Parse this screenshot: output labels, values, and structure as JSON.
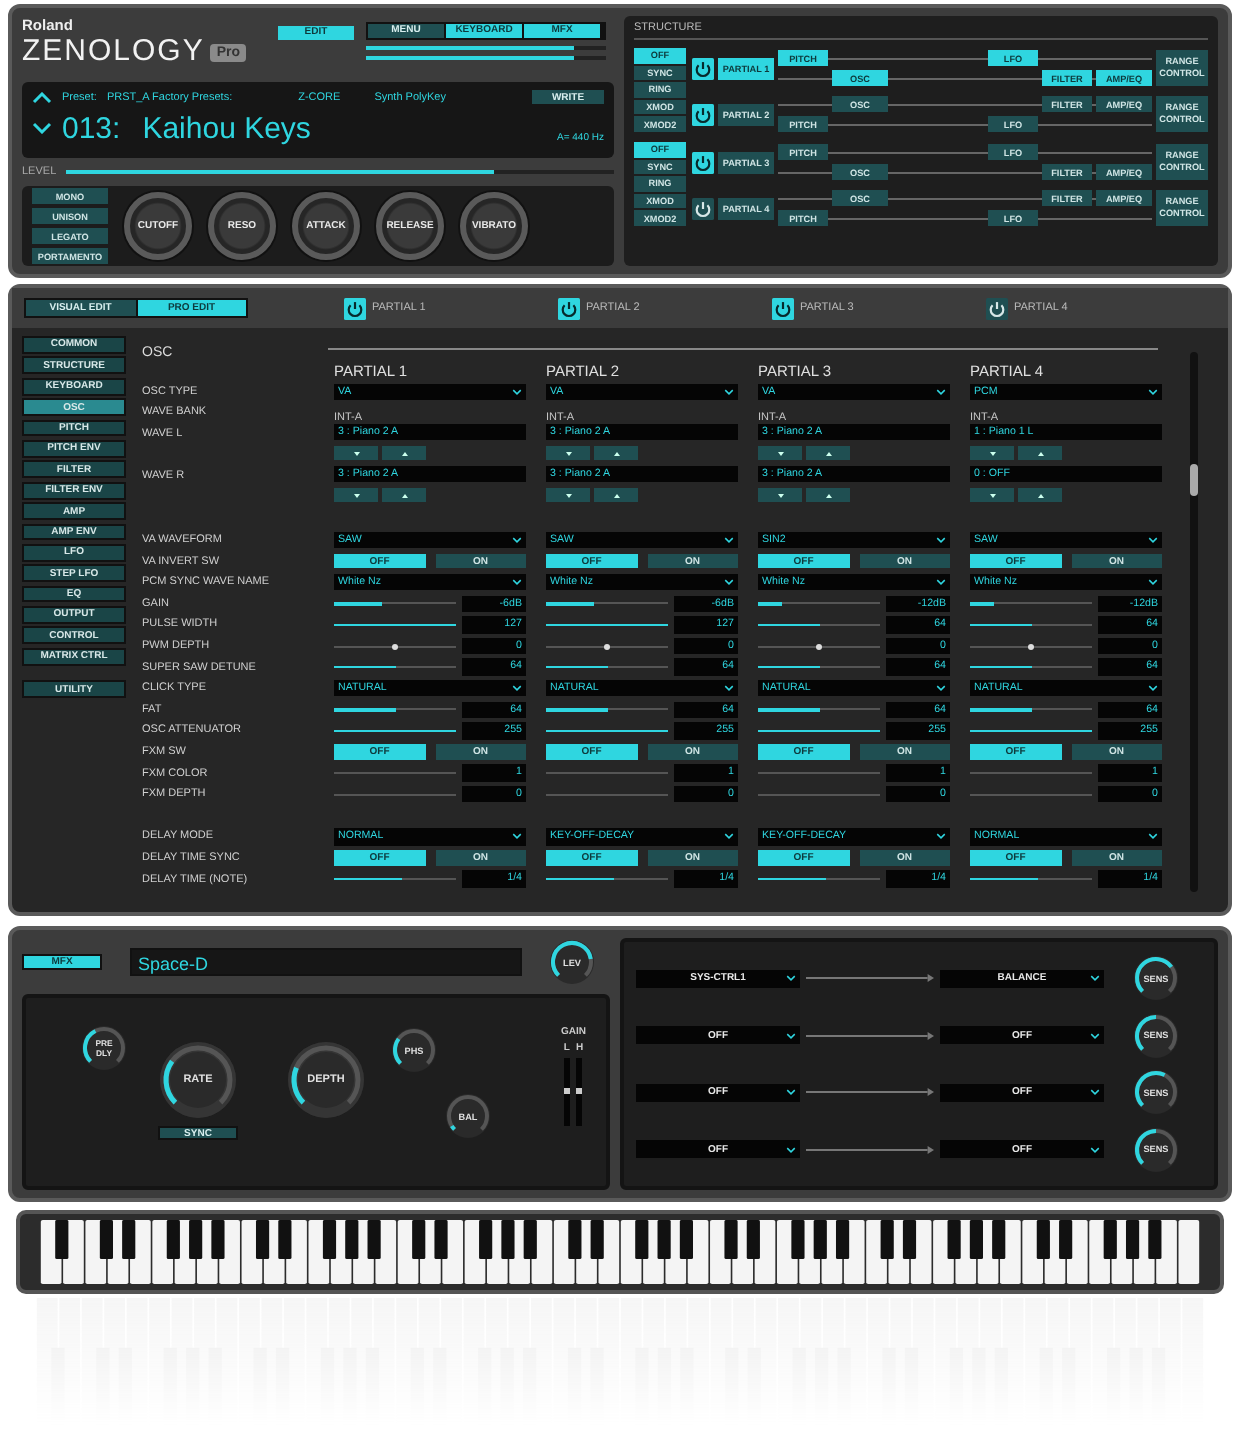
{
  "header": {
    "brand": "Roland",
    "product": "ZENOLOGY",
    "edition": "Pro",
    "edit_button": {
      "label": "EDIT",
      "selected": true
    },
    "nav_tabs": [
      {
        "label": "MENU",
        "selected": false
      },
      {
        "label": "KEYBOARD",
        "selected": true
      },
      {
        "label": "MFX",
        "selected": true
      }
    ],
    "meters": [
      {
        "level": 0.87
      },
      {
        "level": 0.87
      }
    ]
  },
  "preset": {
    "label": "Preset:",
    "bank": "PRST_A Factory Presets:",
    "engine": "Z-CORE",
    "category": "Synth PolyKey",
    "write": "WRITE",
    "number": "013:",
    "name": "Kaihou Keys",
    "tuning": "A= 440 Hz"
  },
  "level": {
    "label": "LEVEL",
    "level": 0.78
  },
  "voice_buttons": [
    "MONO",
    "UNISON",
    "LEGATO",
    "PORTAMENTO"
  ],
  "knobs": [
    "CUTOFF",
    "RESO",
    "ATTACK",
    "RELEASE",
    "VIBRATO"
  ],
  "structure": {
    "title": "STRUCTURE",
    "groups": [
      {
        "modes": [
          {
            "label": "OFF",
            "selected": true
          },
          {
            "label": "SYNC",
            "selected": false
          },
          {
            "label": "RING",
            "selected": false
          },
          {
            "label": "XMOD",
            "selected": false
          },
          {
            "label": "XMOD2",
            "selected": false
          }
        ],
        "partials": [
          {
            "label": "PARTIAL 1",
            "on": true,
            "range": "RANGE CONTROL",
            "blocks": [
              {
                "label": "PITCH",
                "lit": true
              },
              {
                "label": "OSC",
                "lit": true
              },
              {
                "label": "LFO",
                "lit": true
              },
              {
                "label": "FILTER",
                "lit": true
              },
              {
                "label": "AMP/EQ",
                "lit": true
              }
            ]
          },
          {
            "label": "PARTIAL 2",
            "on": true,
            "range": "RANGE CONTROL",
            "blocks": [
              {
                "label": "PITCH",
                "lit": false
              },
              {
                "label": "OSC",
                "lit": false
              },
              {
                "label": "LFO",
                "lit": false
              },
              {
                "label": "FILTER",
                "lit": false
              },
              {
                "label": "AMP/EQ",
                "lit": false
              }
            ]
          }
        ]
      },
      {
        "modes": [
          {
            "label": "OFF",
            "selected": true
          },
          {
            "label": "SYNC",
            "selected": false
          },
          {
            "label": "RING",
            "selected": false
          },
          {
            "label": "XMOD",
            "selected": false
          },
          {
            "label": "XMOD2",
            "selected": false
          }
        ],
        "partials": [
          {
            "label": "PARTIAL 3",
            "on": true,
            "range": "RANGE CONTROL",
            "blocks": [
              {
                "label": "PITCH",
                "lit": false
              },
              {
                "label": "OSC",
                "lit": false
              },
              {
                "label": "LFO",
                "lit": false
              },
              {
                "label": "FILTER",
                "lit": false
              },
              {
                "label": "AMP/EQ",
                "lit": false
              }
            ]
          },
          {
            "label": "PARTIAL 4",
            "on": false,
            "range": "RANGE CONTROL",
            "blocks": [
              {
                "label": "PITCH",
                "lit": false
              },
              {
                "label": "OSC",
                "lit": false
              },
              {
                "label": "LFO",
                "lit": false
              },
              {
                "label": "FILTER",
                "lit": false
              },
              {
                "label": "AMP/EQ",
                "lit": false
              }
            ]
          }
        ]
      }
    ]
  },
  "editor": {
    "tabs": [
      {
        "label": "VISUAL EDIT",
        "selected": false
      },
      {
        "label": "PRO EDIT",
        "selected": true
      }
    ],
    "partial_switches": [
      {
        "label": "PARTIAL 1",
        "on": true
      },
      {
        "label": "PARTIAL 2",
        "on": true
      },
      {
        "label": "PARTIAL 3",
        "on": true
      },
      {
        "label": "PARTIAL 4",
        "on": false
      }
    ],
    "sidebar": [
      {
        "label": "COMMON",
        "selected": false
      },
      {
        "label": "STRUCTURE",
        "selected": false
      },
      {
        "label": "KEYBOARD",
        "selected": false
      },
      {
        "label": "OSC",
        "selected": true
      },
      {
        "label": "PITCH",
        "selected": false
      },
      {
        "label": "PITCH ENV",
        "selected": false
      },
      {
        "label": "FILTER",
        "selected": false
      },
      {
        "label": "FILTER ENV",
        "selected": false
      },
      {
        "label": "AMP",
        "selected": false
      },
      {
        "label": "AMP ENV",
        "selected": false
      },
      {
        "label": "LFO",
        "selected": false
      },
      {
        "label": "STEP LFO",
        "selected": false
      },
      {
        "label": "EQ",
        "selected": false
      },
      {
        "label": "OUTPUT",
        "selected": false
      },
      {
        "label": "CONTROL",
        "selected": false
      },
      {
        "label": "MATRIX CTRL",
        "selected": false
      }
    ],
    "utility": {
      "label": "UTILITY",
      "selected": false
    },
    "section": "OSC",
    "columns": [
      "PARTIAL 1",
      "PARTIAL 2",
      "PARTIAL 3",
      "PARTIAL 4"
    ],
    "rows": [
      {
        "kind": "select",
        "label": "OSC TYPE",
        "cells": [
          {
            "value": "VA"
          },
          {
            "value": "VA"
          },
          {
            "value": "VA"
          },
          {
            "value": "PCM"
          }
        ]
      },
      {
        "kind": "text",
        "label": "WAVE BANK",
        "cells": [
          {
            "value": "INT-A"
          },
          {
            "value": "INT-A"
          },
          {
            "value": "INT-A"
          },
          {
            "value": "INT-A"
          }
        ]
      },
      {
        "kind": "wave",
        "label": "WAVE L",
        "cells": [
          {
            "value": "3 : Piano 2 A"
          },
          {
            "value": "3 : Piano 2 A"
          },
          {
            "value": "3 : Piano 2 A"
          },
          {
            "value": "1 : Piano 1 L"
          }
        ]
      },
      {
        "kind": "wave",
        "label": "WAVE R",
        "cells": [
          {
            "value": "3 : Piano 2 A"
          },
          {
            "value": "3 : Piano 2 A"
          },
          {
            "value": "3 : Piano 2 A"
          },
          {
            "value": "0 : OFF"
          }
        ]
      },
      {
        "kind": "gap"
      },
      {
        "kind": "select",
        "label": "VA WAVEFORM",
        "cells": [
          {
            "value": "SAW"
          },
          {
            "value": "SAW"
          },
          {
            "value": "SIN2"
          },
          {
            "value": "SAW"
          }
        ]
      },
      {
        "kind": "switch",
        "label": "VA INVERT SW",
        "cells": [
          {
            "options": [
              {
                "label": "OFF",
                "selected": true
              },
              {
                "label": "ON",
                "selected": false
              }
            ]
          },
          {
            "options": [
              {
                "label": "OFF",
                "selected": true
              },
              {
                "label": "ON",
                "selected": false
              }
            ]
          },
          {
            "options": [
              {
                "label": "OFF",
                "selected": true
              },
              {
                "label": "ON",
                "selected": false
              }
            ]
          },
          {
            "options": [
              {
                "label": "OFF",
                "selected": true
              },
              {
                "label": "ON",
                "selected": false
              }
            ]
          }
        ]
      },
      {
        "kind": "select",
        "label": "PCM SYNC WAVE NAME",
        "cells": [
          {
            "value": "White Nz"
          },
          {
            "value": "White Nz"
          },
          {
            "value": "White Nz"
          },
          {
            "value": "White Nz"
          }
        ]
      },
      {
        "kind": "slider",
        "label": "GAIN",
        "cells": [
          {
            "level": 0.4,
            "value": "-6dB"
          },
          {
            "level": 0.4,
            "value": "-6dB"
          },
          {
            "level": 0.2,
            "value": "-12dB"
          },
          {
            "level": 0.2,
            "value": "-12dB"
          }
        ]
      },
      {
        "kind": "slider",
        "label": "PULSE WIDTH",
        "cells": [
          {
            "level": 1,
            "value": "127"
          },
          {
            "level": 1,
            "value": "127"
          },
          {
            "level": 0.5,
            "value": "64"
          },
          {
            "level": 0.5,
            "value": "64"
          }
        ]
      },
      {
        "kind": "center",
        "label": "PWM DEPTH",
        "cells": [
          {
            "level": 0.5,
            "value": "0"
          },
          {
            "level": 0.5,
            "value": "0"
          },
          {
            "level": 0.5,
            "value": "0"
          },
          {
            "level": 0.5,
            "value": "0"
          }
        ]
      },
      {
        "kind": "slider",
        "label": "SUPER SAW DETUNE",
        "cells": [
          {
            "level": 0.5,
            "value": "64"
          },
          {
            "level": 0.5,
            "value": "64"
          },
          {
            "level": 0.5,
            "value": "64"
          },
          {
            "level": 0.5,
            "value": "64"
          }
        ]
      },
      {
        "kind": "select",
        "label": "CLICK TYPE",
        "cells": [
          {
            "value": "NATURAL"
          },
          {
            "value": "NATURAL"
          },
          {
            "value": "NATURAL"
          },
          {
            "value": "NATURAL"
          }
        ]
      },
      {
        "kind": "slider",
        "label": "FAT",
        "cells": [
          {
            "level": 0.5,
            "value": "64"
          },
          {
            "level": 0.5,
            "value": "64"
          },
          {
            "level": 0.5,
            "value": "64"
          },
          {
            "level": 0.5,
            "value": "64"
          }
        ]
      },
      {
        "kind": "slider",
        "label": "OSC ATTENUATOR",
        "cells": [
          {
            "level": 1,
            "value": "255"
          },
          {
            "level": 1,
            "value": "255"
          },
          {
            "level": 1,
            "value": "255"
          },
          {
            "level": 1,
            "value": "255"
          }
        ]
      },
      {
        "kind": "switch",
        "label": "FXM SW",
        "cells": [
          {
            "options": [
              {
                "label": "OFF",
                "selected": true
              },
              {
                "label": "ON",
                "selected": false
              }
            ]
          },
          {
            "options": [
              {
                "label": "OFF",
                "selected": true
              },
              {
                "label": "ON",
                "selected": false
              }
            ]
          },
          {
            "options": [
              {
                "label": "OFF",
                "selected": true
              },
              {
                "label": "ON",
                "selected": false
              }
            ]
          },
          {
            "options": [
              {
                "label": "OFF",
                "selected": true
              },
              {
                "label": "ON",
                "selected": false
              }
            ]
          }
        ]
      },
      {
        "kind": "slider",
        "label": "FXM COLOR",
        "cells": [
          {
            "value": "1"
          },
          {
            "value": "1"
          },
          {
            "value": "1"
          },
          {
            "value": "1"
          }
        ]
      },
      {
        "kind": "slider",
        "label": "FXM DEPTH",
        "cells": [
          {
            "value": "0"
          },
          {
            "value": "0"
          },
          {
            "value": "0"
          },
          {
            "value": "0"
          }
        ]
      },
      {
        "kind": "gap"
      },
      {
        "kind": "select",
        "label": "DELAY MODE",
        "cells": [
          {
            "value": "NORMAL"
          },
          {
            "value": "KEY-OFF-DECAY"
          },
          {
            "value": "KEY-OFF-DECAY"
          },
          {
            "value": "NORMAL"
          }
        ]
      },
      {
        "kind": "switch",
        "label": "DELAY TIME SYNC",
        "cells": [
          {
            "options": [
              {
                "label": "OFF",
                "selected": true
              },
              {
                "label": "ON",
                "selected": false
              }
            ]
          },
          {
            "options": [
              {
                "label": "OFF",
                "selected": true
              },
              {
                "label": "ON",
                "selected": false
              }
            ]
          },
          {
            "options": [
              {
                "label": "OFF",
                "selected": true
              },
              {
                "label": "ON",
                "selected": false
              }
            ]
          },
          {
            "options": [
              {
                "label": "OFF",
                "selected": true
              },
              {
                "label": "ON",
                "selected": false
              }
            ]
          }
        ]
      },
      {
        "kind": "slider",
        "label": "DELAY TIME (NOTE)",
        "cells": [
          {
            "level": 0.55,
            "value": "1/4"
          },
          {
            "level": 0.55,
            "value": "1/4"
          },
          {
            "level": 0.55,
            "value": "1/4"
          },
          {
            "level": 0.55,
            "value": "1/4"
          }
        ]
      }
    ]
  },
  "mfx": {
    "button": {
      "label": "MFX",
      "selected": true
    },
    "type": "Space-D",
    "lev": "LEV",
    "pre_dly": "PRE DLY",
    "rate": "RATE",
    "sync": "SYNC",
    "depth": "DEPTH",
    "phs": "PHS",
    "bal": "BAL",
    "gain": {
      "label": "GAIN",
      "channels": [
        {
          "label": "L",
          "level": 0.5
        },
        {
          "label": "H",
          "level": 0.5
        }
      ]
    },
    "controls": [
      {
        "source": "SYS-CTRL1",
        "destination": "BALANCE",
        "sens": "SENS"
      },
      {
        "source": "OFF",
        "destination": "OFF",
        "sens": "SENS"
      },
      {
        "source": "OFF",
        "destination": "OFF",
        "sens": "SENS"
      },
      {
        "source": "OFF",
        "destination": "OFF",
        "sens": "SENS"
      }
    ]
  }
}
